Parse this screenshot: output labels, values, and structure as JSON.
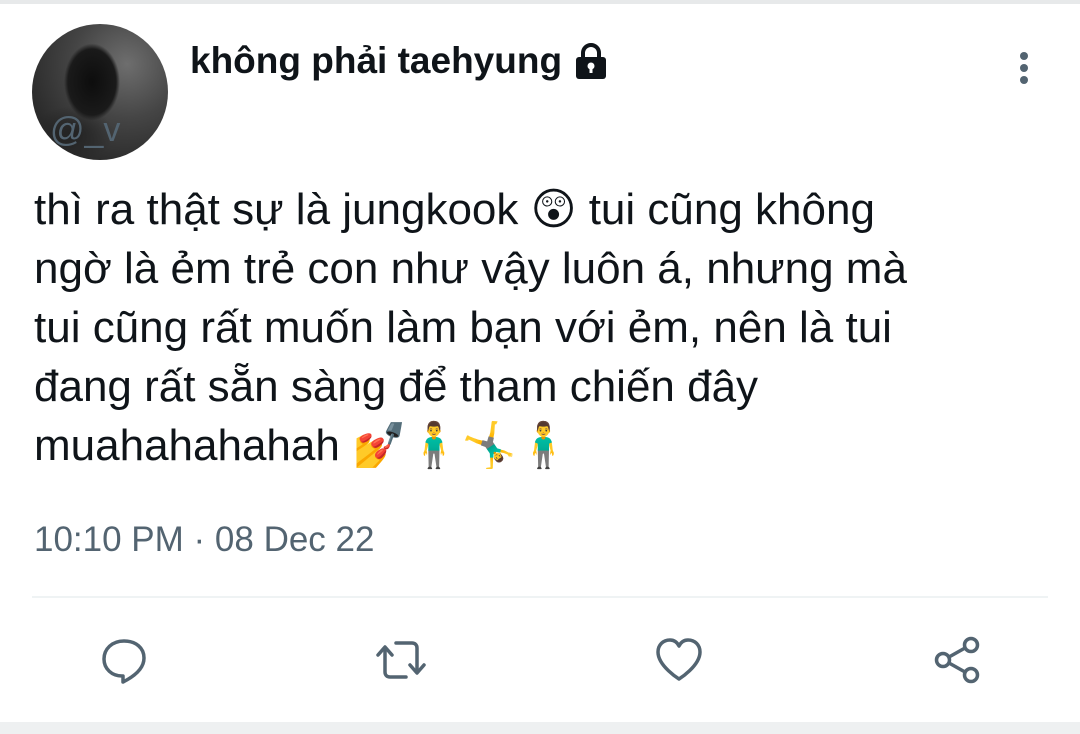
{
  "tweet": {
    "author": {
      "display_name": "không phải taehyung",
      "handle": "@_v",
      "protected_icon": "lock-icon"
    },
    "text_lines": [
      "thì ra thật sự là jungkook 😲 tui cũng không",
      "ngờ là ẻm trẻ con như vậy luôn á, nhưng mà",
      "tui cũng rất muốn làm bạn với ẻm, nên là tui",
      "đang rất sẵn sàng để tham chiến đây",
      "muahahahahah 💅🧍‍♂️🤸‍♂️🧍‍♂️"
    ],
    "timestamp": "10:10 PM · 08 Dec 22"
  },
  "actions": {
    "reply_icon": "reply-icon",
    "retweet_icon": "retweet-icon",
    "like_icon": "heart-icon",
    "share_icon": "share-icon"
  },
  "colors": {
    "text": "#0f1419",
    "secondary": "#536471",
    "icon": "#536471",
    "divider": "#eff3f4"
  }
}
